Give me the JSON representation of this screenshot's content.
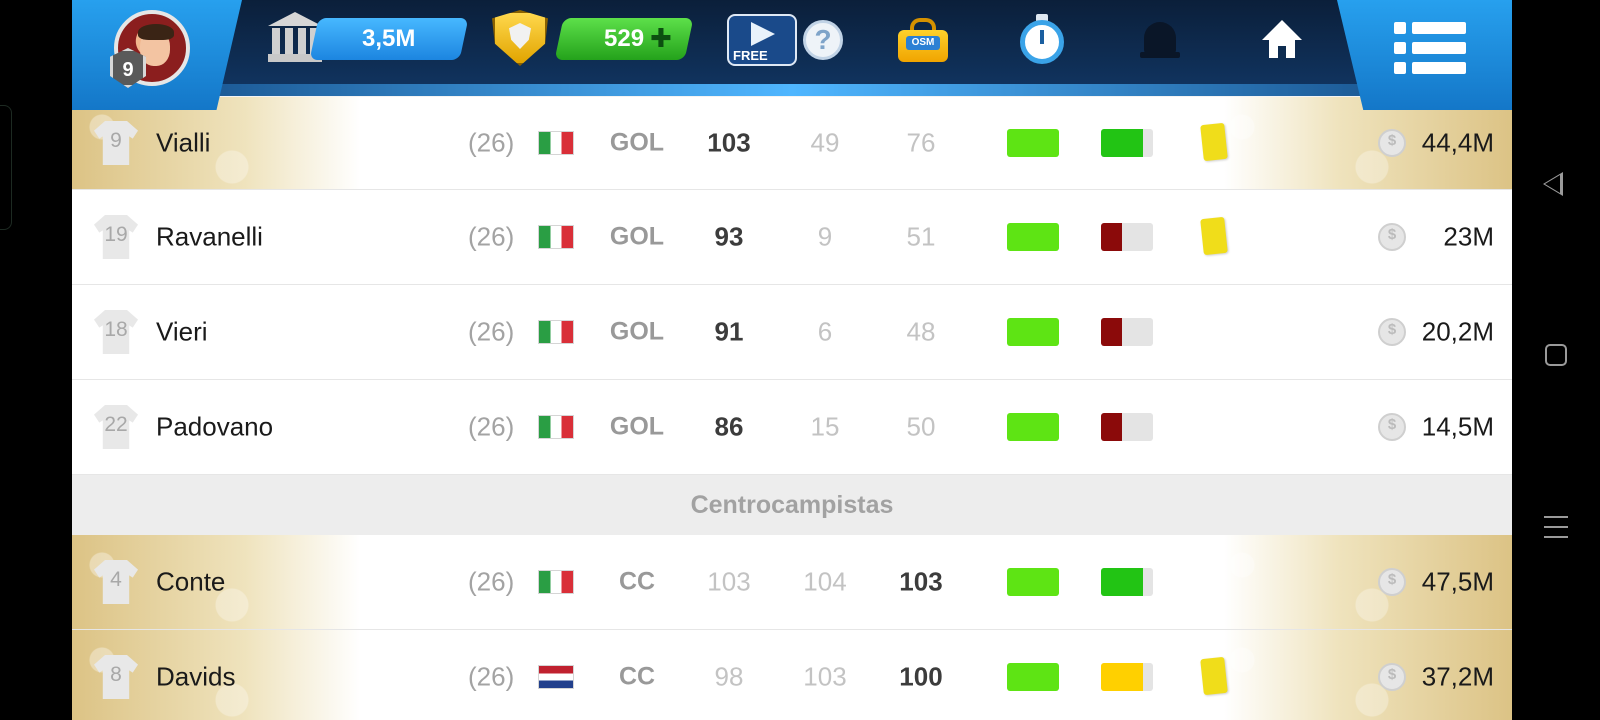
{
  "header": {
    "level": "9",
    "money": "3,5M",
    "coins": "529",
    "free_label": "FREE",
    "help_label": "?",
    "osm_label": "OSM"
  },
  "sections": [
    {
      "title": "",
      "players": [
        {
          "number": "9",
          "name": "Vialli",
          "age": "(26)",
          "flag": "it",
          "position": "GOL",
          "att": "103",
          "mid": "49",
          "def": "76",
          "main_stat": "att",
          "morale_level": 0.8,
          "morale_color": "#22c414",
          "yellow_card": true,
          "value": "44,4M",
          "gold": true
        },
        {
          "number": "19",
          "name": "Ravanelli",
          "age": "(26)",
          "flag": "it",
          "position": "GOL",
          "att": "93",
          "mid": "9",
          "def": "51",
          "main_stat": "att",
          "morale_level": 0.4,
          "morale_color": "#8b0a0a",
          "yellow_card": true,
          "value": "23M",
          "gold": false
        },
        {
          "number": "18",
          "name": "Vieri",
          "age": "(26)",
          "flag": "it",
          "position": "GOL",
          "att": "91",
          "mid": "6",
          "def": "48",
          "main_stat": "att",
          "morale_level": 0.4,
          "morale_color": "#8b0a0a",
          "yellow_card": false,
          "value": "20,2M",
          "gold": false
        },
        {
          "number": "22",
          "name": "Padovano",
          "age": "(26)",
          "flag": "it",
          "position": "GOL",
          "att": "86",
          "mid": "15",
          "def": "50",
          "main_stat": "att",
          "morale_level": 0.4,
          "morale_color": "#8b0a0a",
          "yellow_card": false,
          "value": "14,5M",
          "gold": false
        }
      ]
    },
    {
      "title": "Centrocampistas",
      "players": [
        {
          "number": "4",
          "name": "Conte",
          "age": "(26)",
          "flag": "it",
          "position": "CC",
          "att": "103",
          "mid": "104",
          "def": "103",
          "main_stat": "def",
          "morale_level": 0.8,
          "morale_color": "#22c414",
          "yellow_card": false,
          "value": "47,5M",
          "gold": true
        },
        {
          "number": "8",
          "name": "Davids",
          "age": "(26)",
          "flag": "nl",
          "position": "CC",
          "att": "98",
          "mid": "103",
          "def": "100",
          "main_stat": "def",
          "morale_level": 0.8,
          "morale_color": "#ffd000",
          "yellow_card": true,
          "value": "37,2M",
          "gold": true
        }
      ]
    }
  ],
  "colors": {
    "fitness": "#5ee414",
    "topbar": "#10335e",
    "accent_blue": "#1c85e0"
  }
}
